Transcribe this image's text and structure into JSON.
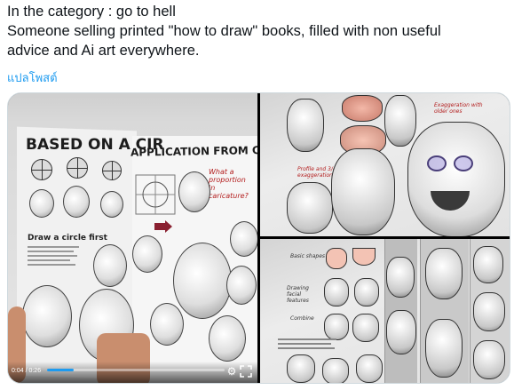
{
  "tweet": {
    "line1": "In the category : go to hell",
    "line2": "Someone selling printed \"how to draw\" books, filled with non useful",
    "line3": "advice and Ai art everywhere.",
    "translate_label": "แปลโพสต์"
  },
  "media": {
    "main": {
      "heading_left": "BASED ON A CIR",
      "heading_right": "APPLICATION FROM CLASSIC",
      "subheading": "Draw a circle first",
      "note": "What a proportion in caricature?",
      "video": {
        "time_text": "0:04 / 0:26",
        "progress": 0.15
      }
    },
    "top_right": {
      "note_right": "Exaggeration with older ones",
      "note_left": "Profile and 3/4 exaggeration"
    },
    "bottom_right": {
      "label1": "Basic shapes",
      "label2": "Drawing facial features",
      "label3": "Combine"
    }
  },
  "icons": {
    "settings": "gear-icon",
    "fullscreen": "fullscreen-icon"
  },
  "colors": {
    "text": "#0f1419",
    "link": "#1d9bf0",
    "border": "#cfd9de",
    "progress": "#1d9bf0"
  }
}
